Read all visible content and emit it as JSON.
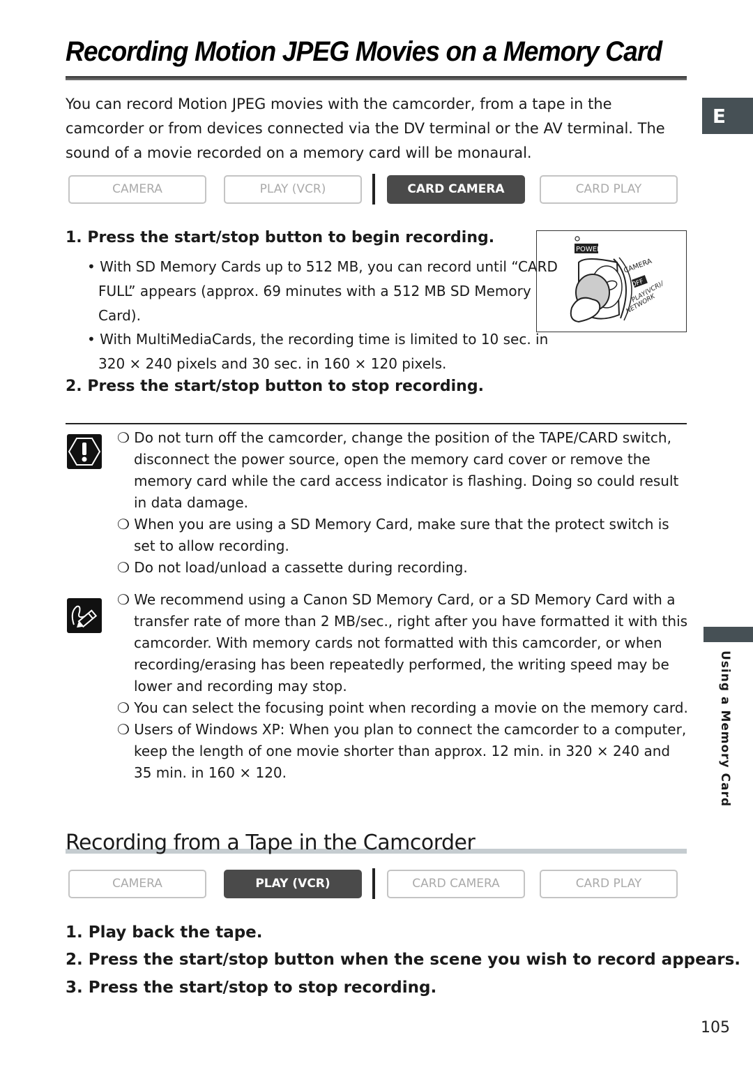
{
  "page": {
    "title": "Recording Motion JPEG Movies on a Memory Card",
    "intro": "You can record Motion JPEG movies with the camcorder, from a tape in the camcorder or from devices connected via the DV terminal or the AV terminal. The sound of a movie recorded on a memory card will be monaural.",
    "language_tab": "E",
    "side_label": "Using a Memory Card",
    "page_number": "105"
  },
  "mode_bar_1": {
    "modes": [
      "CAMERA",
      "PLAY (VCR)",
      "CARD CAMERA",
      "CARD PLAY"
    ],
    "active": "CARD CAMERA"
  },
  "section1": {
    "steps": [
      {
        "label": "1. Press the start/stop button to begin recording.",
        "bullets": [
          "• With SD Memory Cards up to 512 MB, you can record until “CARD FULL” appears (approx. 69 minutes with a 512 MB SD Memory Card).",
          "• With MultiMediaCards, the recording time is limited to 10 sec. in 320 × 240 pixels and 30 sec. in 160 × 120 pixels."
        ]
      },
      {
        "label": "2. Press the start/stop button to stop recording."
      }
    ],
    "figure": {
      "power_label": "POWER",
      "positions": [
        "CAMERA",
        "OFF",
        "PLAY(VCR)/",
        "NETWORK"
      ]
    }
  },
  "cautions": [
    "❍ Do not turn off the camcorder, change the position of the TAPE/CARD switch, disconnect the power source, open the memory card cover or remove the memory card while the card access indicator is flashing. Doing so could result in data damage.",
    "❍ When you are using a SD Memory Card, make sure that the protect switch is set to allow recording.",
    "❍ Do not load/unload a cassette during recording."
  ],
  "notes": [
    "❍ We recommend using a Canon SD Memory Card, or a SD Memory Card with a transfer rate of more than 2 MB/sec., right after you have formatted it with this camcorder. With memory cards not formatted with this camcorder, or when recording/erasing has been repeatedly performed, the writing speed may be lower and recording may stop.",
    "❍ You can select the focusing point when recording a movie on the memory card.",
    "❍ Users of Windows XP: When you plan to connect the camcorder to a computer, keep the length of one movie shorter than approx. 12 min. in 320 × 240 and 35 min. in 160 × 120."
  ],
  "section2": {
    "heading": "Recording from a Tape in the Camcorder",
    "mode_bar": {
      "modes": [
        "CAMERA",
        "PLAY (VCR)",
        "CARD CAMERA",
        "CARD PLAY"
      ],
      "active": "PLAY (VCR)"
    },
    "steps": [
      "1. Play back the tape.",
      "2. Press the start/stop button when the scene you wish to record appears.",
      "3. Press the start/stop to stop recording."
    ]
  }
}
